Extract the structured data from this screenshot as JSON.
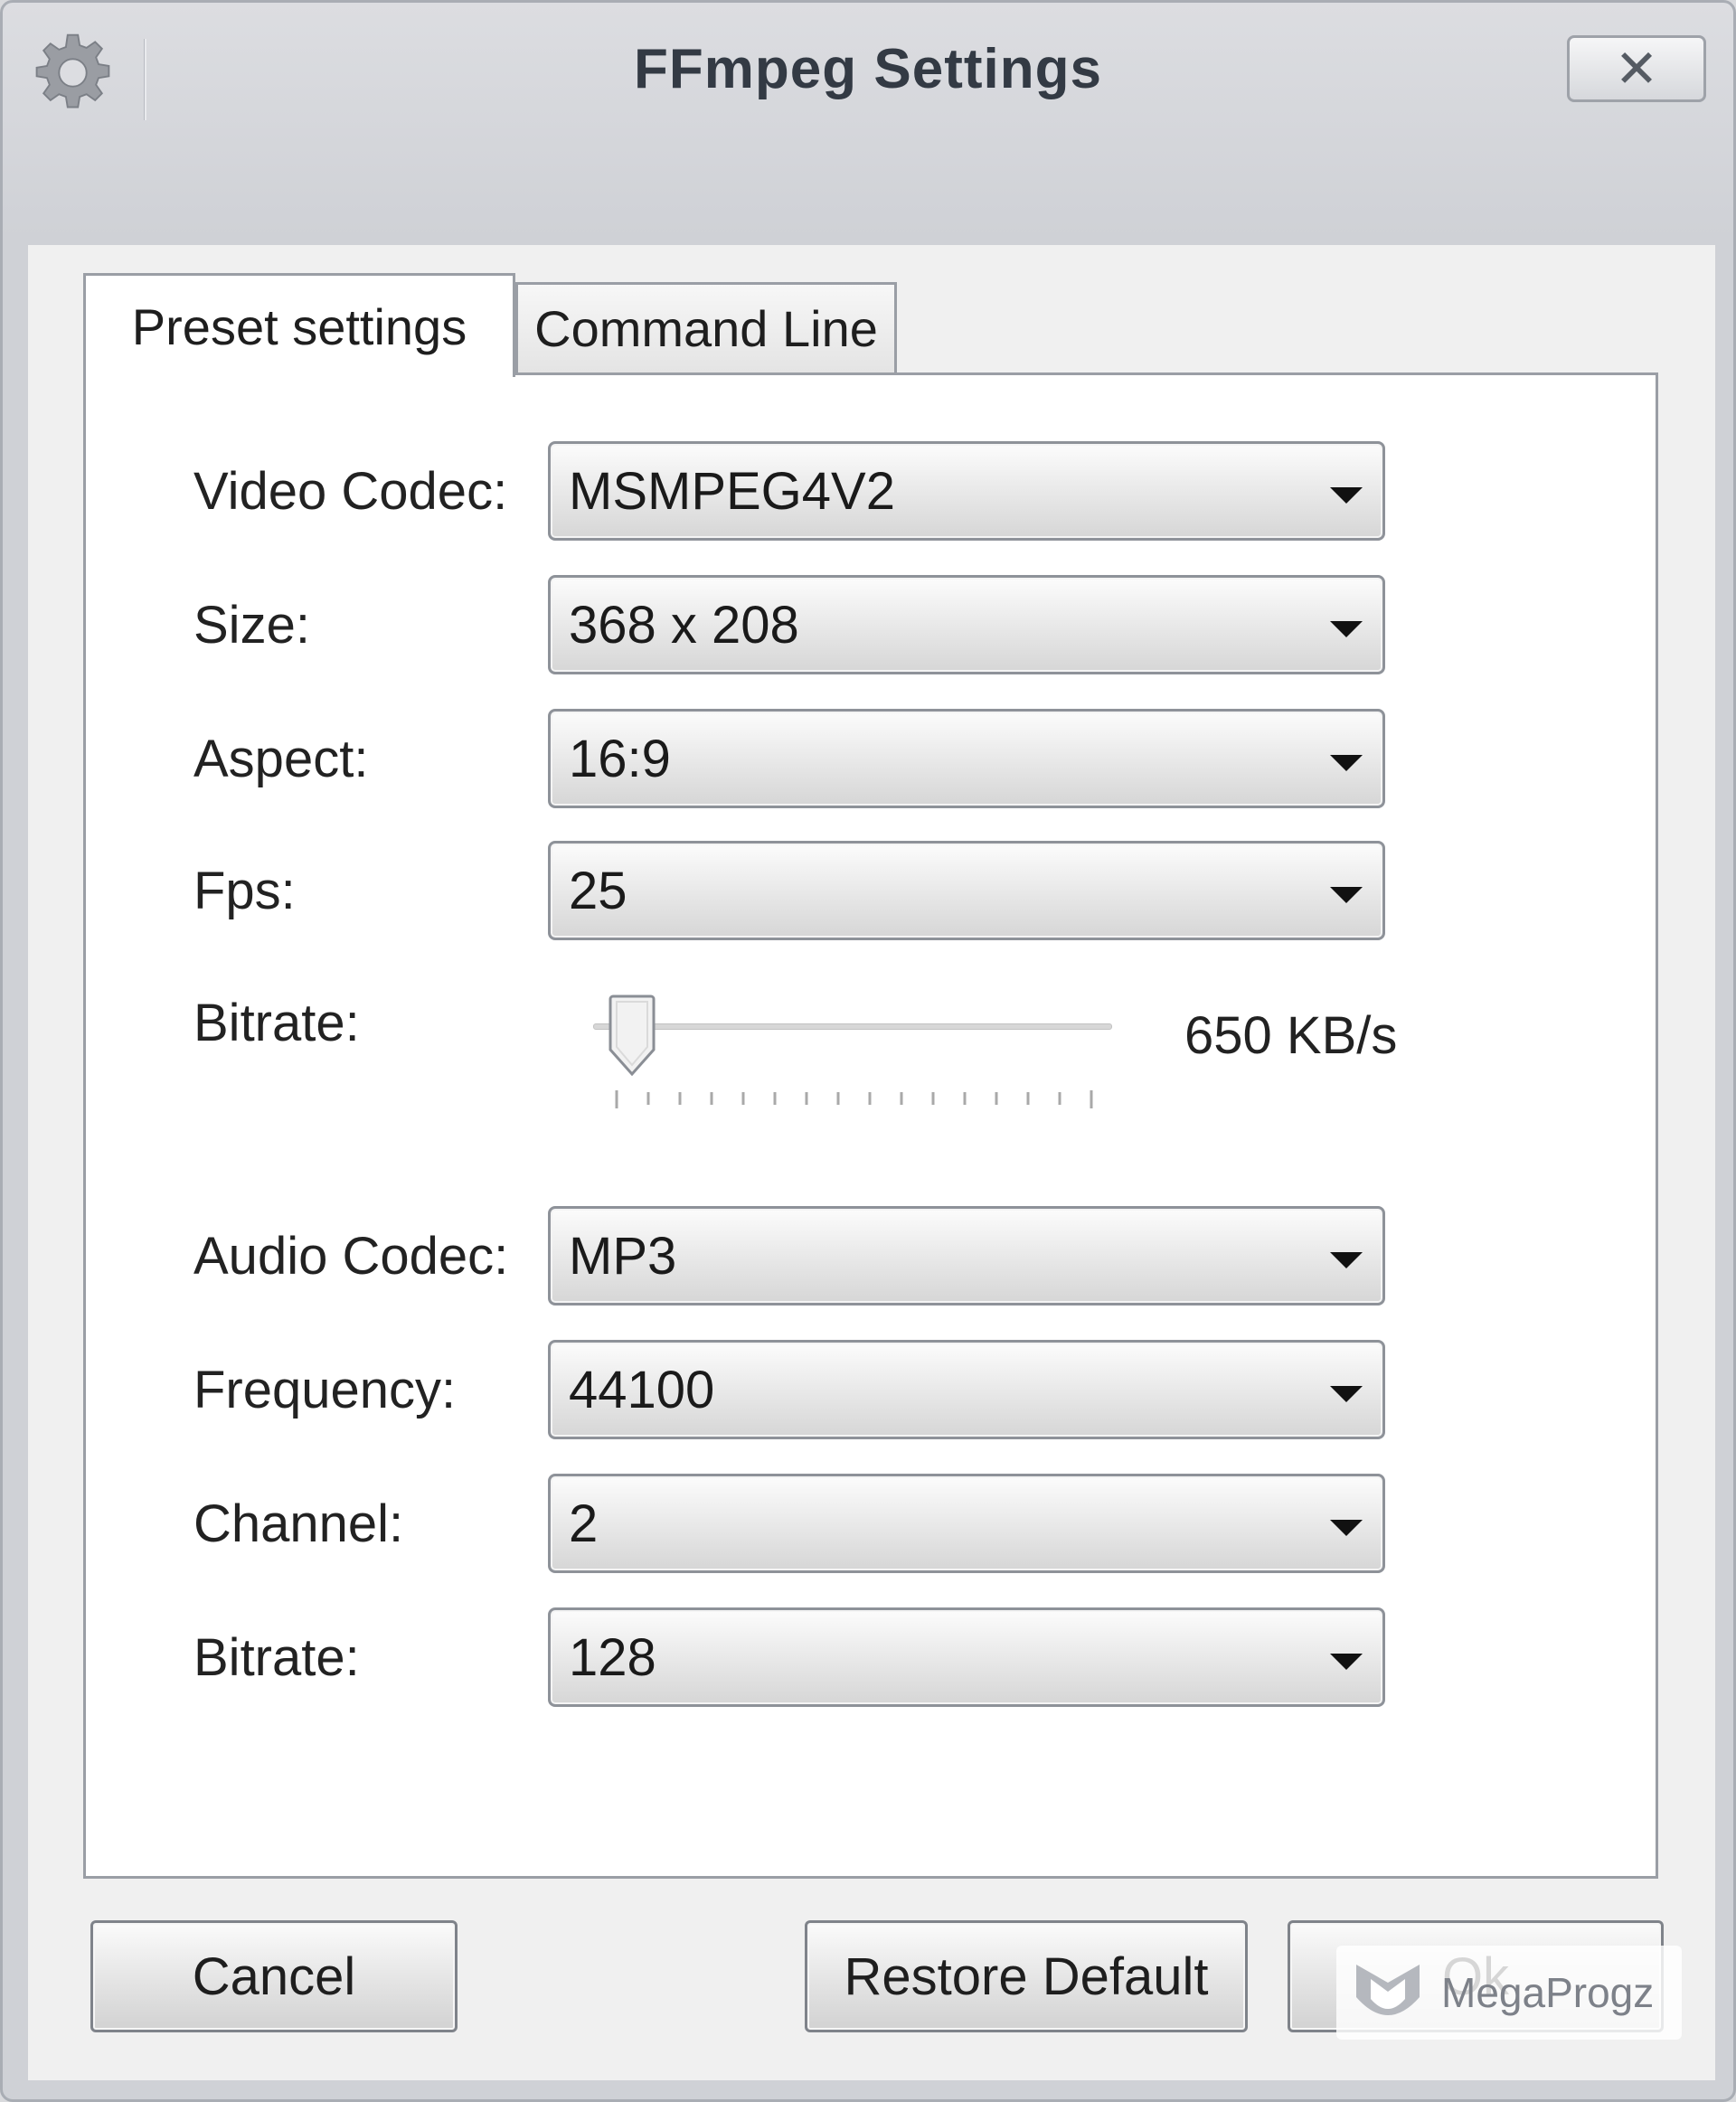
{
  "window": {
    "title": "FFmpeg Settings",
    "close_label": "✕"
  },
  "tabs": [
    {
      "label": "Preset settings",
      "active": true
    },
    {
      "label": "Command Line",
      "active": false
    }
  ],
  "video": {
    "codec": {
      "label": "Video Codec:",
      "value": "MSMPEG4V2"
    },
    "size": {
      "label": "Size:",
      "value": "368 x 208"
    },
    "aspect": {
      "label": "Aspect:",
      "value": "16:9"
    },
    "fps": {
      "label": "Fps:",
      "value": "25"
    },
    "bitrate": {
      "label": "Bitrate:",
      "value_text": "650 KB/s",
      "slider_position": 0.06
    }
  },
  "audio": {
    "codec": {
      "label": "Audio Codec:",
      "value": "MP3"
    },
    "frequency": {
      "label": "Frequency:",
      "value": "44100"
    },
    "channel": {
      "label": "Channel:",
      "value": "2"
    },
    "bitrate": {
      "label": "Bitrate:",
      "value": "128"
    }
  },
  "buttons": {
    "cancel": "Cancel",
    "restore_default": "Restore Default",
    "ok": "Ok"
  },
  "watermark": {
    "text": "MegaProgz"
  },
  "colors": {
    "window_bg": "#cfd1d6",
    "panel_bg": "#ffffff",
    "border": "#9a9ea5"
  }
}
